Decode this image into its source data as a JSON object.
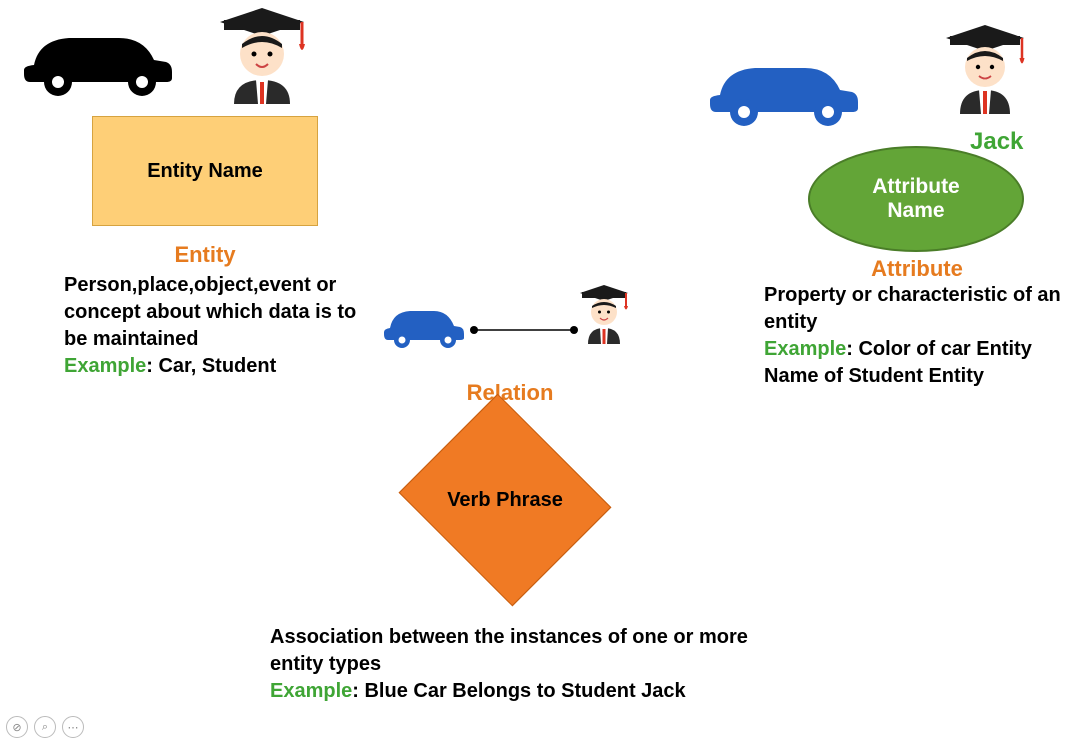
{
  "entity": {
    "box_label": "Entity Name",
    "title": "Entity",
    "description": "Person,place,object,event or concept about which data is to be maintained",
    "example_label": "Example",
    "example_text": ": Car, Student"
  },
  "relation": {
    "diamond_label": "Verb Phrase",
    "title": "Relation",
    "description": "Association between the instances of one or more entity types",
    "example_label": "Example",
    "example_text": ": Blue Car Belongs to Student Jack"
  },
  "attribute": {
    "ellipse_label": "Attribute Name",
    "title": "Attribute",
    "student_name": "Jack",
    "description": "Property or characteristic of an entity",
    "example_label": "Example",
    "example_text": ": Color of car Entity Name of Student Entity"
  },
  "icons": {
    "car_black": "car-black",
    "car_blue_large": "car-blue-large",
    "car_blue_small": "car-blue-small",
    "student_large": "student-large",
    "student_medium": "student-medium",
    "student_small": "student-small"
  }
}
